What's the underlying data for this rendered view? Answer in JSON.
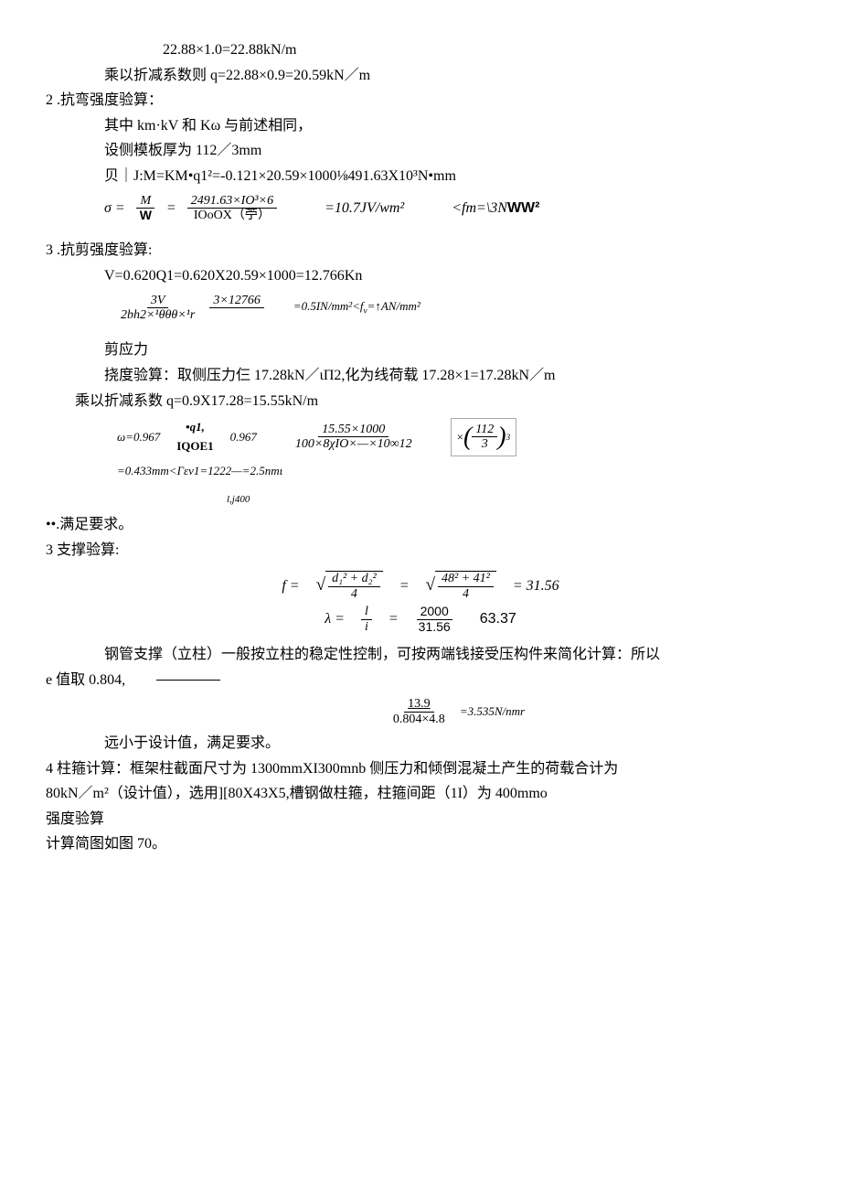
{
  "l1": "22.88×1.0=22.88kN/m",
  "l2": "乘以折减系数则 q=22.88×0.9=20.59kN／m",
  "s2_title": "2 .抗弯强度验算：",
  "s2_a": "其中 km·kV 和 Kω 与前述相同，",
  "s2_b": "设侧模板厚为 112／3mm",
  "s2_c": "贝｜J:M=KM•q1²=-0.121×20.59×1000⅛491.63X10³N•mm",
  "sigma_eq": "σ =",
  "sigma_frac_num_M": "M",
  "sigma_frac_den_W": "W",
  "sigma_eq2": "=",
  "sigma_num2": "2491.63×IO³×6",
  "sigma_den2": "IOoOX（苧）",
  "sigma_val": "=10.7JV/wm²",
  "sigma_cond": "<fm=\\3NWW²",
  "s3_title": "3 .抗剪强度验算:",
  "s3_a": "V=0.620Q1=0.620X20.59×1000=12.766Kn",
  "tau_num1": "3V",
  "tau_den1": "2bh2×¹θθθ×¹r",
  "tau_num2": "3×12766",
  "tau_val": "=0.5IN/mm²<fᵥ=↑AN/mm²",
  "s3_b": "剪应力",
  "s3_c": "挠度验算：取侧压力仨 17.28kN／ιΠ2,化为线荷载 17.28×1=17.28kN／m",
  "s3_d": "乘以折减系数 q=0.9X17.28=15.55kN/m",
  "omega1": "ω=0.967",
  "omega_q": "•q1,",
  "omega_iqo": "IQOE1",
  "omega_v": "0.967",
  "omega_num": "15.55×1000",
  "omega_den": "100×8χIO×—×10∞12",
  "omega_box_num": "112",
  "omega_box_den": "3",
  "omega_box_exp": "3",
  "omega_res": "=0.433mm<Γεv1=1222—=2.5nmι",
  "omega_res_sub": "l,j400",
  "s3_e": "••.满足要求。",
  "s4_title": "3 支撑验算:",
  "f_eq": "f =",
  "f_n1": "d₁² + d₂²",
  "f_d1": "4",
  "f_n2": "48² + 41²",
  "f_d2": "4",
  "f_res": "= 31.56",
  "lambda_eq": "λ  =",
  "lambda_n1": "l",
  "lambda_d1": "i",
  "lambda_n2": "2000",
  "lambda_d2": "31.56",
  "lambda_res": "63.37",
  "s4_a": "钢管支撑（立柱）一般按立柱的稳定性控制，可按两端钱接受压构件来简化计算：所以",
  "s4_b": "e 值取 0.804,",
  "s4_num": "13.9",
  "s4_den": "0.804×4.8",
  "s4_res": "=3.535N/nmr",
  "s4_c": "远小于设计值，满足要求。",
  "s5_a": "4 柱箍计算：框架柱截面尺寸为 1300mmXI300mnb 侧压力和倾倒混凝土产生的荷载合计为",
  "s5_b": "80kN／m²（设计值），选用][80X43X5,槽钢做柱箍，柱箍间距（1I）为 400mmo",
  "s5_c": "强度验算",
  "s5_d": "计算简图如图 70。"
}
